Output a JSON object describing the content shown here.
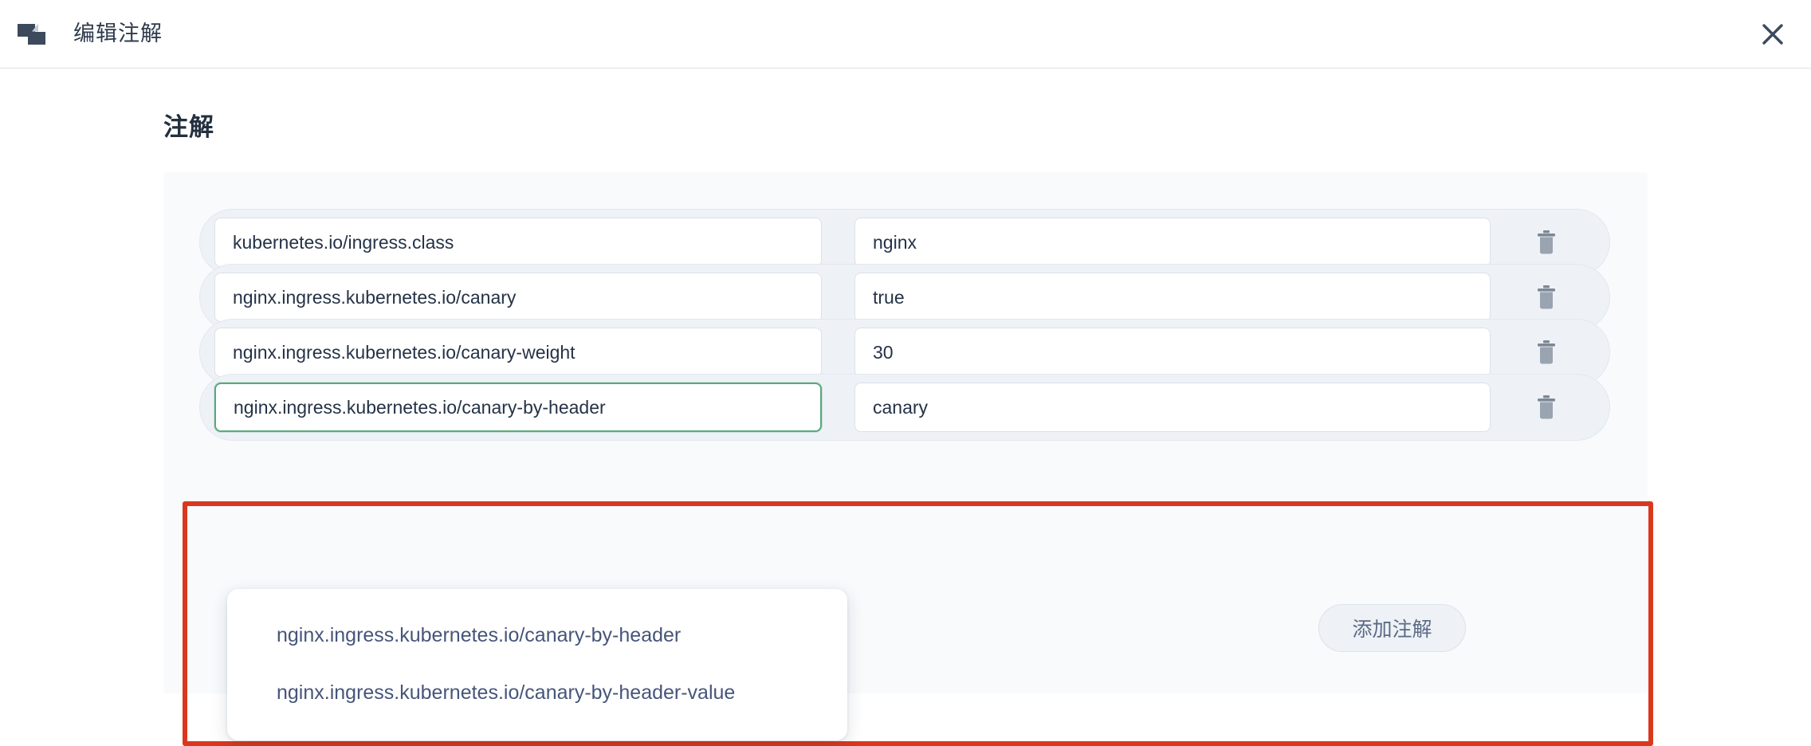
{
  "window": {
    "title": "编辑注解",
    "icon": "layers-icon",
    "close_icon": "close-icon"
  },
  "section": {
    "title": "注解"
  },
  "annotations": {
    "rows": [
      {
        "key": "kubernetes.io/ingress.class",
        "value": "nginx",
        "key_placeholder": "",
        "value_placeholder": "",
        "focused": false,
        "delete_icon": "trash-icon"
      },
      {
        "key": "nginx.ingress.kubernetes.io/canary",
        "value": "true",
        "key_placeholder": "",
        "value_placeholder": "",
        "focused": false,
        "delete_icon": "trash-icon"
      },
      {
        "key": "nginx.ingress.kubernetes.io/canary-weight",
        "value": "30",
        "key_placeholder": "",
        "value_placeholder": "",
        "focused": false,
        "delete_icon": "trash-icon"
      },
      {
        "key": "nginx.ingress.kubernetes.io/canary-by-header",
        "value": "canary",
        "key_placeholder": "",
        "value_placeholder": "",
        "focused": true,
        "delete_icon": "trash-icon"
      }
    ]
  },
  "suggestions": {
    "visible": true,
    "items": [
      "nginx.ingress.kubernetes.io/canary-by-header",
      "nginx.ingress.kubernetes.io/canary-by-header-value"
    ]
  },
  "actions": {
    "add_label": "添加注解"
  },
  "colors": {
    "highlight_box": "#d9381e",
    "focus_border": "#5aa97d",
    "title_text": "#2e3b4e",
    "panel_bg": "#f8fafc",
    "row_bg": "#eef2f7",
    "suggestion_text": "#46557a"
  }
}
